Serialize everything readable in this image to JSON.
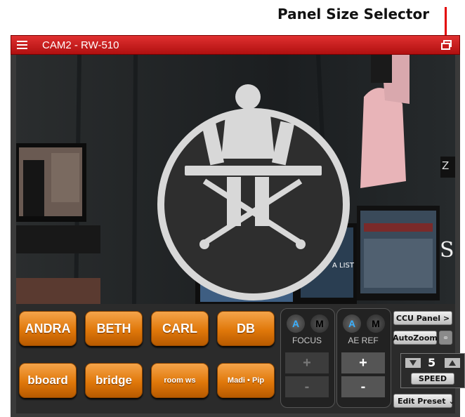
{
  "annotation": {
    "label": "Panel Size Selector"
  },
  "window": {
    "title": "CAM2 - RW-510"
  },
  "presets": {
    "row1": [
      "ANDRA",
      "BETH",
      "CARL",
      "DB"
    ],
    "row2": [
      "bboard",
      "bridge",
      "room ws",
      "Madi • Pip"
    ]
  },
  "focus": {
    "auto_label": "A",
    "manual_label": "M",
    "label": "FOCUS",
    "plus": "+",
    "minus": "-"
  },
  "ae_ref": {
    "auto_label": "A",
    "manual_label": "M",
    "label": "AE REF",
    "plus": "+",
    "minus": "-"
  },
  "side": {
    "ccu_panel": "CCU Panel >",
    "autozoom": "AutoZoom",
    "speed_value": "5",
    "speed_label": "SPEED",
    "edit_preset": "Edit Preset"
  },
  "colors": {
    "titlebar": "#c81a1a",
    "preset_button": "#e8830f",
    "auto_accent": "#3ab0ff"
  },
  "icons": {
    "menu": "hamburger-icon",
    "panel_size": "window-restore-icon",
    "autozoom_toggle": "link-icon"
  }
}
